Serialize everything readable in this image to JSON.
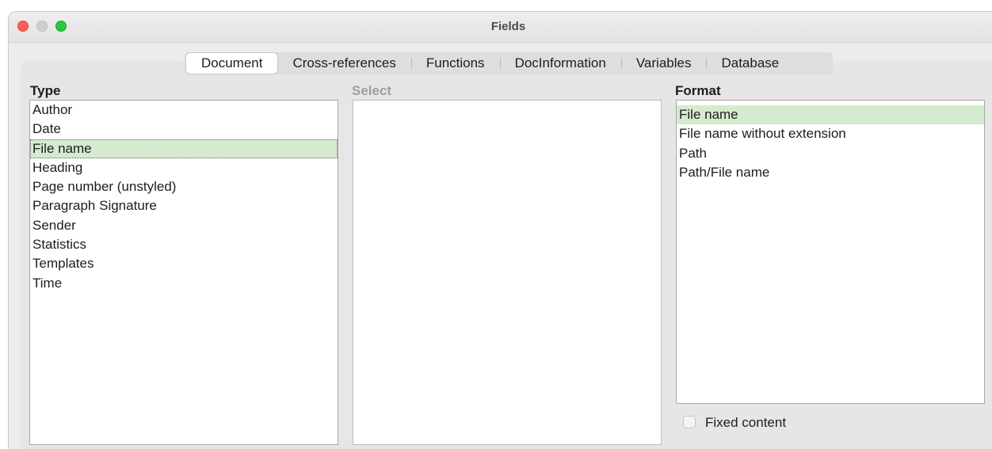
{
  "window": {
    "title": "Fields"
  },
  "tabs": [
    {
      "label": "Document",
      "active": true
    },
    {
      "label": "Cross-references",
      "active": false
    },
    {
      "label": "Functions",
      "active": false
    },
    {
      "label": "DocInformation",
      "active": false
    },
    {
      "label": "Variables",
      "active": false
    },
    {
      "label": "Database",
      "active": false
    }
  ],
  "type": {
    "label": "Type",
    "items": [
      "Author",
      "Date",
      "File name",
      "Heading",
      "Page number (unstyled)",
      "Paragraph Signature",
      "Sender",
      "Statistics",
      "Templates",
      "Time"
    ],
    "selected": "File name"
  },
  "select": {
    "label": "Select",
    "items": []
  },
  "format": {
    "label": "Format",
    "items": [
      "File name",
      "File name without extension",
      "Path",
      "Path/File name"
    ],
    "selected": "File name"
  },
  "fixed_content": {
    "label": "Fixed content",
    "checked": false
  },
  "colors": {
    "selection": "#d5ebcf",
    "close": "#ff5f57",
    "maximize": "#28c840"
  }
}
